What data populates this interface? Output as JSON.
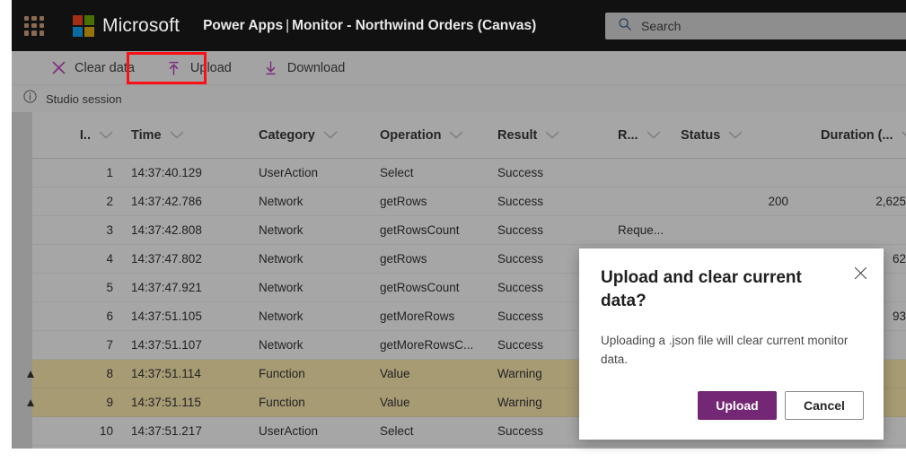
{
  "suitebar": {
    "waffle_label": "App launcher",
    "brand": "Microsoft",
    "app_name": "Power Apps",
    "separator": "|",
    "page_name": "Monitor - Northwind Orders (Canvas)"
  },
  "search": {
    "placeholder": "Search",
    "value": ""
  },
  "toolbar": {
    "clear_label": "Clear data",
    "upload_label": "Upload",
    "download_label": "Download",
    "highlight_color": "#fb1016",
    "highlighted": "Upload"
  },
  "session": {
    "label": "Studio session"
  },
  "table": {
    "columns": [
      {
        "key": "id",
        "label": "I.."
      },
      {
        "key": "time",
        "label": "Time"
      },
      {
        "key": "category",
        "label": "Category"
      },
      {
        "key": "operation",
        "label": "Operation"
      },
      {
        "key": "result",
        "label": "Result"
      },
      {
        "key": "request",
        "label": "R..."
      },
      {
        "key": "status",
        "label": "Status"
      },
      {
        "key": "duration",
        "label": "Duration (..."
      }
    ],
    "rows": [
      {
        "warn": "",
        "id": "1",
        "time": "14:37:40.129",
        "category": "UserAction",
        "operation": "Select",
        "result": "Success",
        "request": "",
        "status": "",
        "duration": ""
      },
      {
        "warn": "",
        "id": "2",
        "time": "14:37:42.786",
        "category": "Network",
        "operation": "getRows",
        "result": "Success",
        "request": "",
        "status": "200",
        "duration": "2,625"
      },
      {
        "warn": "",
        "id": "3",
        "time": "14:37:42.808",
        "category": "Network",
        "operation": "getRowsCount",
        "result": "Success",
        "request": "Reque...",
        "status": "",
        "duration": ""
      },
      {
        "warn": "",
        "id": "4",
        "time": "14:37:47.802",
        "category": "Network",
        "operation": "getRows",
        "result": "Success",
        "request": "",
        "status": "",
        "duration": "62"
      },
      {
        "warn": "",
        "id": "5",
        "time": "14:37:47.921",
        "category": "Network",
        "operation": "getRowsCount",
        "result": "Success",
        "request": "",
        "status": "",
        "duration": ""
      },
      {
        "warn": "",
        "id": "6",
        "time": "14:37:51.105",
        "category": "Network",
        "operation": "getMoreRows",
        "result": "Success",
        "request": "",
        "status": "",
        "duration": "93"
      },
      {
        "warn": "",
        "id": "7",
        "time": "14:37:51.107",
        "category": "Network",
        "operation": "getMoreRowsC...",
        "result": "Success",
        "request": "",
        "status": "",
        "duration": ""
      },
      {
        "warn": "▲",
        "id": "8",
        "time": "14:37:51.114",
        "category": "Function",
        "operation": "Value",
        "result": "Warning",
        "request": "",
        "status": "",
        "duration": ""
      },
      {
        "warn": "▲",
        "id": "9",
        "time": "14:37:51.115",
        "category": "Function",
        "operation": "Value",
        "result": "Warning",
        "request": "",
        "status": "",
        "duration": ""
      },
      {
        "warn": "",
        "id": "10",
        "time": "14:37:51.217",
        "category": "UserAction",
        "operation": "Select",
        "result": "Success",
        "request": "",
        "status": "",
        "duration": ""
      }
    ]
  },
  "dialog": {
    "title": "Upload and clear current data?",
    "body": "Uploading a .json file will clear current monitor data.",
    "primary_label": "Upload",
    "secondary_label": "Cancel",
    "primary_color": "#742774"
  }
}
